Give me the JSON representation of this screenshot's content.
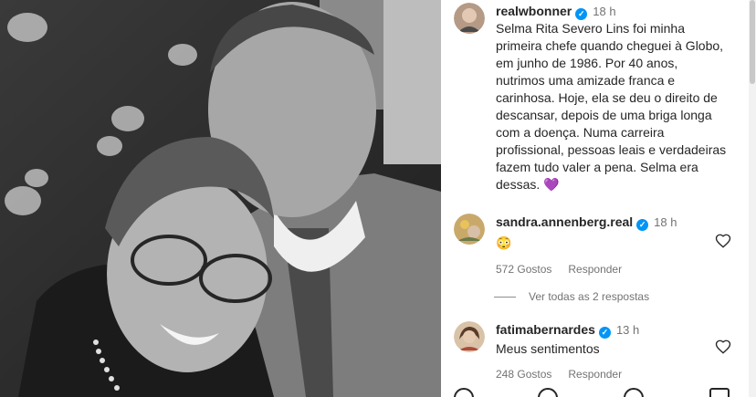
{
  "post": {
    "author": "realwbonner",
    "time": "18 h",
    "caption": "Selma Rita Severo Lins foi minha\nprimeira chefe quando cheguei à Globo,\nem junho de 1986. Por 40 anos,\nnutrimos uma amizade franca e\ncarinhosa. Hoje, ela se deu o direito de\ndescansar, depois de uma briga longa\ncom a  doença. Numa carreira\nprofissional, pessoas leais e verdadeiras\nfazem tudo valer a pena. Selma era\ndessas.",
    "caption_emoji": "💜"
  },
  "comments": [
    {
      "username": "sandra.annenberg.real",
      "time": "18 h",
      "text": "😳",
      "likes": "572 Gostos",
      "reply": "Responder",
      "view_replies": "Ver todas as 2 respostas"
    },
    {
      "username": "fatimabernardes",
      "time": "13 h",
      "text": "Meus sentimentos",
      "likes": "248 Gostos",
      "reply": "Responder"
    }
  ],
  "icons": [
    "verified-badge-icon",
    "heart-icon",
    "comment-icon",
    "share-icon",
    "bookmark-icon"
  ],
  "colors": {
    "verified": "#0095f6",
    "secondary_text": "#737373"
  }
}
